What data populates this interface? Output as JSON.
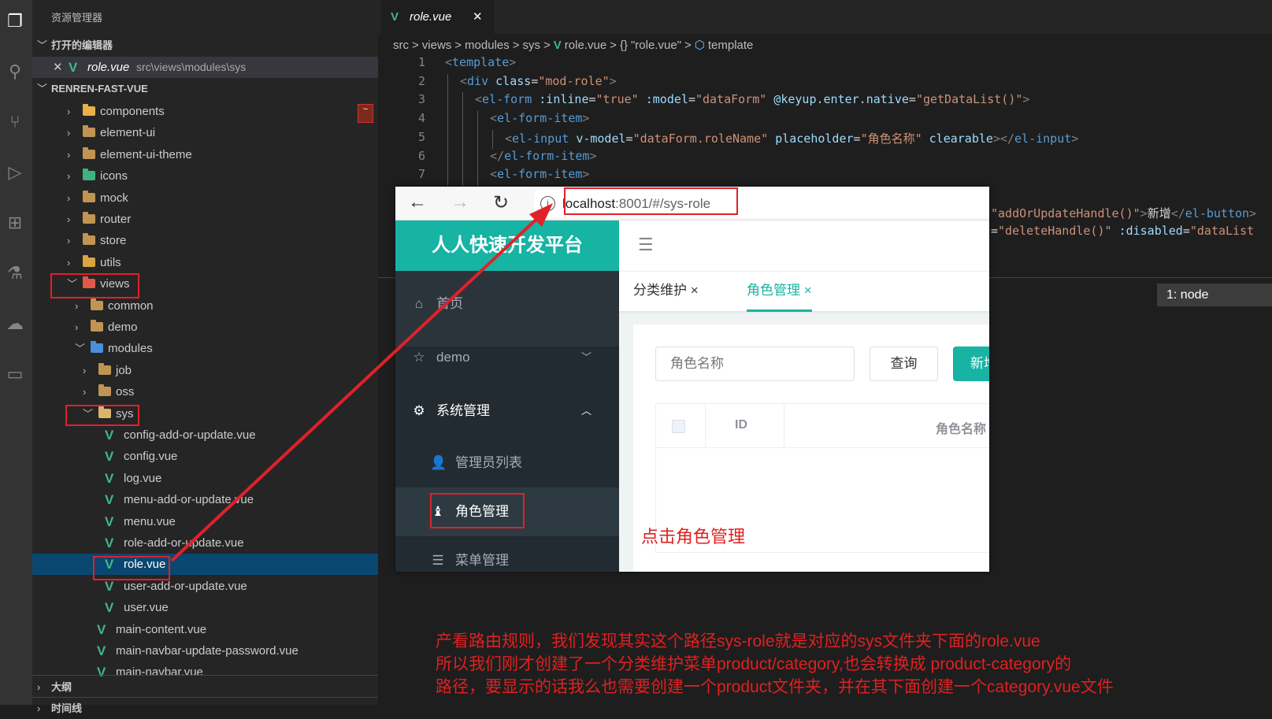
{
  "activity_icons": [
    "explorer-icon",
    "search-icon",
    "source-control-icon",
    "run-debug-icon",
    "extensions-icon",
    "test-icon",
    "remote-icon",
    "folder-icon"
  ],
  "sidebar": {
    "title": "资源管理器",
    "open_editors_label": "打开的编辑器",
    "open_editor": {
      "name": "role.vue",
      "path": "src\\views\\modules\\sys"
    },
    "project_label": "RENREN-FAST-VUE",
    "outline_label": "大纲",
    "timeline_label": "时间线",
    "tree": [
      {
        "label": "components",
        "level": 1,
        "kind": "folder",
        "state": "collapsed",
        "color": "#e8b248"
      },
      {
        "label": "element-ui",
        "level": 1,
        "kind": "folder",
        "state": "collapsed",
        "color": "#c09553"
      },
      {
        "label": "element-ui-theme",
        "level": 1,
        "kind": "folder",
        "state": "collapsed",
        "color": "#c09553"
      },
      {
        "label": "icons",
        "level": 1,
        "kind": "folder",
        "state": "collapsed",
        "color": "#3fb27f"
      },
      {
        "label": "mock",
        "level": 1,
        "kind": "folder",
        "state": "collapsed",
        "color": "#c09553"
      },
      {
        "label": "router",
        "level": 1,
        "kind": "folder",
        "state": "collapsed",
        "color": "#c09553"
      },
      {
        "label": "store",
        "level": 1,
        "kind": "folder",
        "state": "collapsed",
        "color": "#c09553"
      },
      {
        "label": "utils",
        "level": 1,
        "kind": "folder",
        "state": "collapsed",
        "color": "#d9a441"
      },
      {
        "label": "views",
        "level": 1,
        "kind": "folder",
        "state": "expanded",
        "color": "#e05a4a"
      },
      {
        "label": "common",
        "level": 2,
        "kind": "folder",
        "state": "collapsed",
        "color": "#c09553"
      },
      {
        "label": "demo",
        "level": 2,
        "kind": "folder",
        "state": "collapsed",
        "color": "#c09553"
      },
      {
        "label": "modules",
        "level": 2,
        "kind": "folder",
        "state": "expanded",
        "color": "#4a90d9"
      },
      {
        "label": "job",
        "level": 3,
        "kind": "folder",
        "state": "collapsed",
        "color": "#c09553"
      },
      {
        "label": "oss",
        "level": 3,
        "kind": "folder",
        "state": "collapsed",
        "color": "#c09553"
      },
      {
        "label": "sys",
        "level": 3,
        "kind": "folder",
        "state": "expanded",
        "color": "#d9b46a"
      },
      {
        "label": "config-add-or-update.vue",
        "level": 4,
        "kind": "vue"
      },
      {
        "label": "config.vue",
        "level": 4,
        "kind": "vue"
      },
      {
        "label": "log.vue",
        "level": 4,
        "kind": "vue"
      },
      {
        "label": "menu-add-or-update.vue",
        "level": 4,
        "kind": "vue"
      },
      {
        "label": "menu.vue",
        "level": 4,
        "kind": "vue"
      },
      {
        "label": "role-add-or-update.vue",
        "level": 4,
        "kind": "vue"
      },
      {
        "label": "role.vue",
        "level": 4,
        "kind": "vue",
        "selected": true
      },
      {
        "label": "user-add-or-update.vue",
        "level": 4,
        "kind": "vue"
      },
      {
        "label": "user.vue",
        "level": 4,
        "kind": "vue"
      },
      {
        "label": "main-content.vue",
        "level": 3,
        "kind": "vue"
      },
      {
        "label": "main-navbar-update-password.vue",
        "level": 3,
        "kind": "vue"
      },
      {
        "label": "main-navbar.vue",
        "level": 3,
        "kind": "vue"
      }
    ]
  },
  "editor": {
    "tab": {
      "label": "role.vue",
      "close": "✕"
    },
    "breadcrumb": [
      "src",
      ">",
      "views",
      ">",
      "modules",
      ">",
      "sys",
      ">",
      "V",
      "role.vue",
      ">",
      "{}",
      "\"role.vue\"",
      ">",
      "⬡",
      "template"
    ],
    "lines": [
      {
        "n": "1",
        "indent": 0,
        "tokens": [
          [
            "p",
            "<"
          ],
          [
            "t",
            "template"
          ],
          [
            "p",
            ">"
          ]
        ]
      },
      {
        "n": "2",
        "indent": 1,
        "tokens": [
          [
            "p",
            "<"
          ],
          [
            "t",
            "div"
          ],
          [
            "x",
            " "
          ],
          [
            "a",
            "class"
          ],
          [
            "x",
            "="
          ],
          [
            "s",
            "\"mod-role\""
          ],
          [
            "p",
            ">"
          ]
        ]
      },
      {
        "n": "3",
        "indent": 2,
        "tokens": [
          [
            "p",
            "<"
          ],
          [
            "t",
            "el-form"
          ],
          [
            "x",
            " "
          ],
          [
            "a",
            ":inline"
          ],
          [
            "x",
            "="
          ],
          [
            "s",
            "\"true\""
          ],
          [
            "x",
            " "
          ],
          [
            "a",
            ":model"
          ],
          [
            "x",
            "="
          ],
          [
            "s",
            "\"dataForm\""
          ],
          [
            "x",
            " "
          ],
          [
            "a",
            "@keyup.enter.native"
          ],
          [
            "x",
            "="
          ],
          [
            "s",
            "\"getDataList()\""
          ],
          [
            "p",
            ">"
          ]
        ]
      },
      {
        "n": "4",
        "indent": 3,
        "tokens": [
          [
            "p",
            "<"
          ],
          [
            "t",
            "el-form-item"
          ],
          [
            "p",
            ">"
          ]
        ]
      },
      {
        "n": "5",
        "indent": 4,
        "tokens": [
          [
            "p",
            "<"
          ],
          [
            "t",
            "el-input"
          ],
          [
            "x",
            " "
          ],
          [
            "a",
            "v-model"
          ],
          [
            "x",
            "="
          ],
          [
            "s",
            "\"dataForm.roleName\""
          ],
          [
            "x",
            " "
          ],
          [
            "a",
            "placeholder"
          ],
          [
            "x",
            "="
          ],
          [
            "s",
            "\"角色名称\""
          ],
          [
            "x",
            " "
          ],
          [
            "a",
            "clearable"
          ],
          [
            "p",
            "></"
          ],
          [
            "t",
            "el-input"
          ],
          [
            "p",
            ">"
          ]
        ]
      },
      {
        "n": "6",
        "indent": 3,
        "tokens": [
          [
            "p",
            "</"
          ],
          [
            "t",
            "el-form-item"
          ],
          [
            "p",
            ">"
          ]
        ]
      },
      {
        "n": "7",
        "indent": 3,
        "tokens": [
          [
            "p",
            "<"
          ],
          [
            "t",
            "el-form-item"
          ],
          [
            "p",
            ">"
          ]
        ]
      }
    ],
    "fragments": [
      [
        [
          "s",
          "\"addOrUpdateHandle()\""
        ],
        [
          "p",
          ">"
        ],
        [
          "x",
          "新增"
        ],
        [
          "p",
          "</"
        ],
        [
          "t",
          "el-button"
        ],
        [
          "p",
          ">"
        ]
      ],
      [
        [
          "x",
          "="
        ],
        [
          "s",
          "\"deleteHandle()\""
        ],
        [
          "x",
          " "
        ],
        [
          "a",
          ":disabled"
        ],
        [
          "x",
          "="
        ],
        [
          "s",
          "\"dataList"
        ]
      ]
    ],
    "terminal_label": "1: node"
  },
  "browser": {
    "url_host": "localhost",
    "url_rest": ":8001/#/sys-role",
    "logo": "人人快速开发平台",
    "menu": [
      {
        "label": "首页",
        "icon": "home-icon",
        "glyph": "⌂"
      },
      {
        "label": "demo",
        "icon": "star-icon",
        "glyph": "☆",
        "chevron": "﹀"
      },
      {
        "label": "系统管理",
        "icon": "gear-icon",
        "glyph": "⚙",
        "chevron": "︿"
      },
      {
        "label": "管理员列表",
        "icon": "user-icon",
        "glyph": "👤"
      },
      {
        "label": "角色管理",
        "icon": "role-icon",
        "glyph": "♝",
        "active": true
      },
      {
        "label": "菜单管理",
        "icon": "list-icon",
        "glyph": "☰"
      }
    ],
    "tabs": [
      {
        "label": "分类维护",
        "close": "×"
      },
      {
        "label": "角色管理",
        "close": "×",
        "active": true
      }
    ],
    "search_placeholder": "角色名称",
    "query_button": "查询",
    "add_button": "新增",
    "table_headers": [
      "ID",
      "角色名称"
    ],
    "accent": "#17b3a3"
  },
  "annotations": {
    "click_hint": "点击角色管理",
    "notes": [
      "产看路由规则，我们发现其实这个路径sys-role就是对应的sys文件夹下面的role.vue",
      "所以我们刚才创建了一个分类维护菜单product/category,也会转换成 product-category的",
      "路径，要显示的话我么也需要创建一个product文件夹，并在其下面创建一个category.vue文件"
    ],
    "color": "#e0212a"
  }
}
